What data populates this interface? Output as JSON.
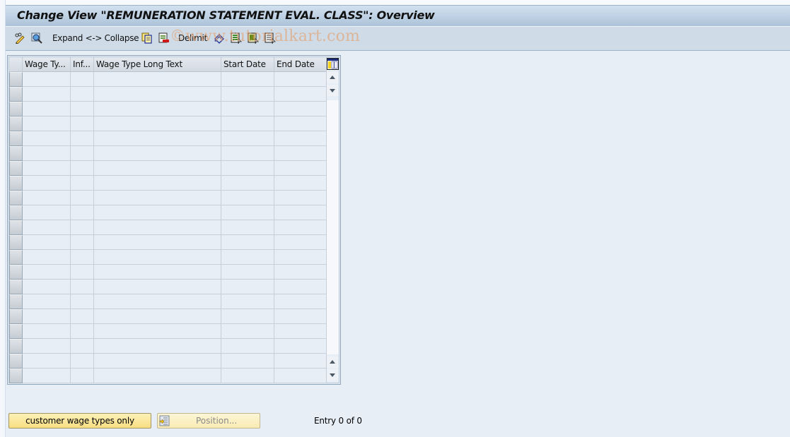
{
  "window": {
    "title": "Change View \"REMUNERATION STATEMENT EVAL. CLASS\": Overview"
  },
  "toolbar": {
    "items": [
      {
        "icon": "display-change-icon",
        "label": ""
      },
      {
        "icon": "details-icon",
        "label": ""
      },
      {
        "icon": "",
        "label": "Expand <-> Collapse"
      },
      {
        "icon": "copy-as-icon",
        "label": ""
      },
      {
        "icon": "delete-icon",
        "label": ""
      },
      {
        "icon": "",
        "label": "Delimit"
      },
      {
        "icon": "undo-change-icon",
        "label": ""
      },
      {
        "icon": "select-all-icon",
        "label": ""
      },
      {
        "icon": "select-block-icon",
        "label": ""
      },
      {
        "icon": "deselect-all-icon",
        "label": ""
      }
    ],
    "expand_collapse_label": "Expand <-> Collapse",
    "delimit_label": "Delimit"
  },
  "watermark": "©www.tutorialkart.com",
  "table": {
    "columns": [
      "Wage Ty...",
      "Inf...",
      "Wage Type Long Text",
      "Start Date",
      "End Date"
    ],
    "rows": [],
    "visible_empty_rows": 21,
    "column_config_icon": "table-settings-icon"
  },
  "footer": {
    "customer_button_label": "customer wage types only",
    "position_button_label": "Position...",
    "position_button_enabled": false,
    "entry_text": "Entry 0 of 0"
  },
  "colors": {
    "titlebar": "#adc3da",
    "toolbar": "#cfdce7",
    "background": "#e8eef6",
    "button_yellow": "#f8de82"
  }
}
